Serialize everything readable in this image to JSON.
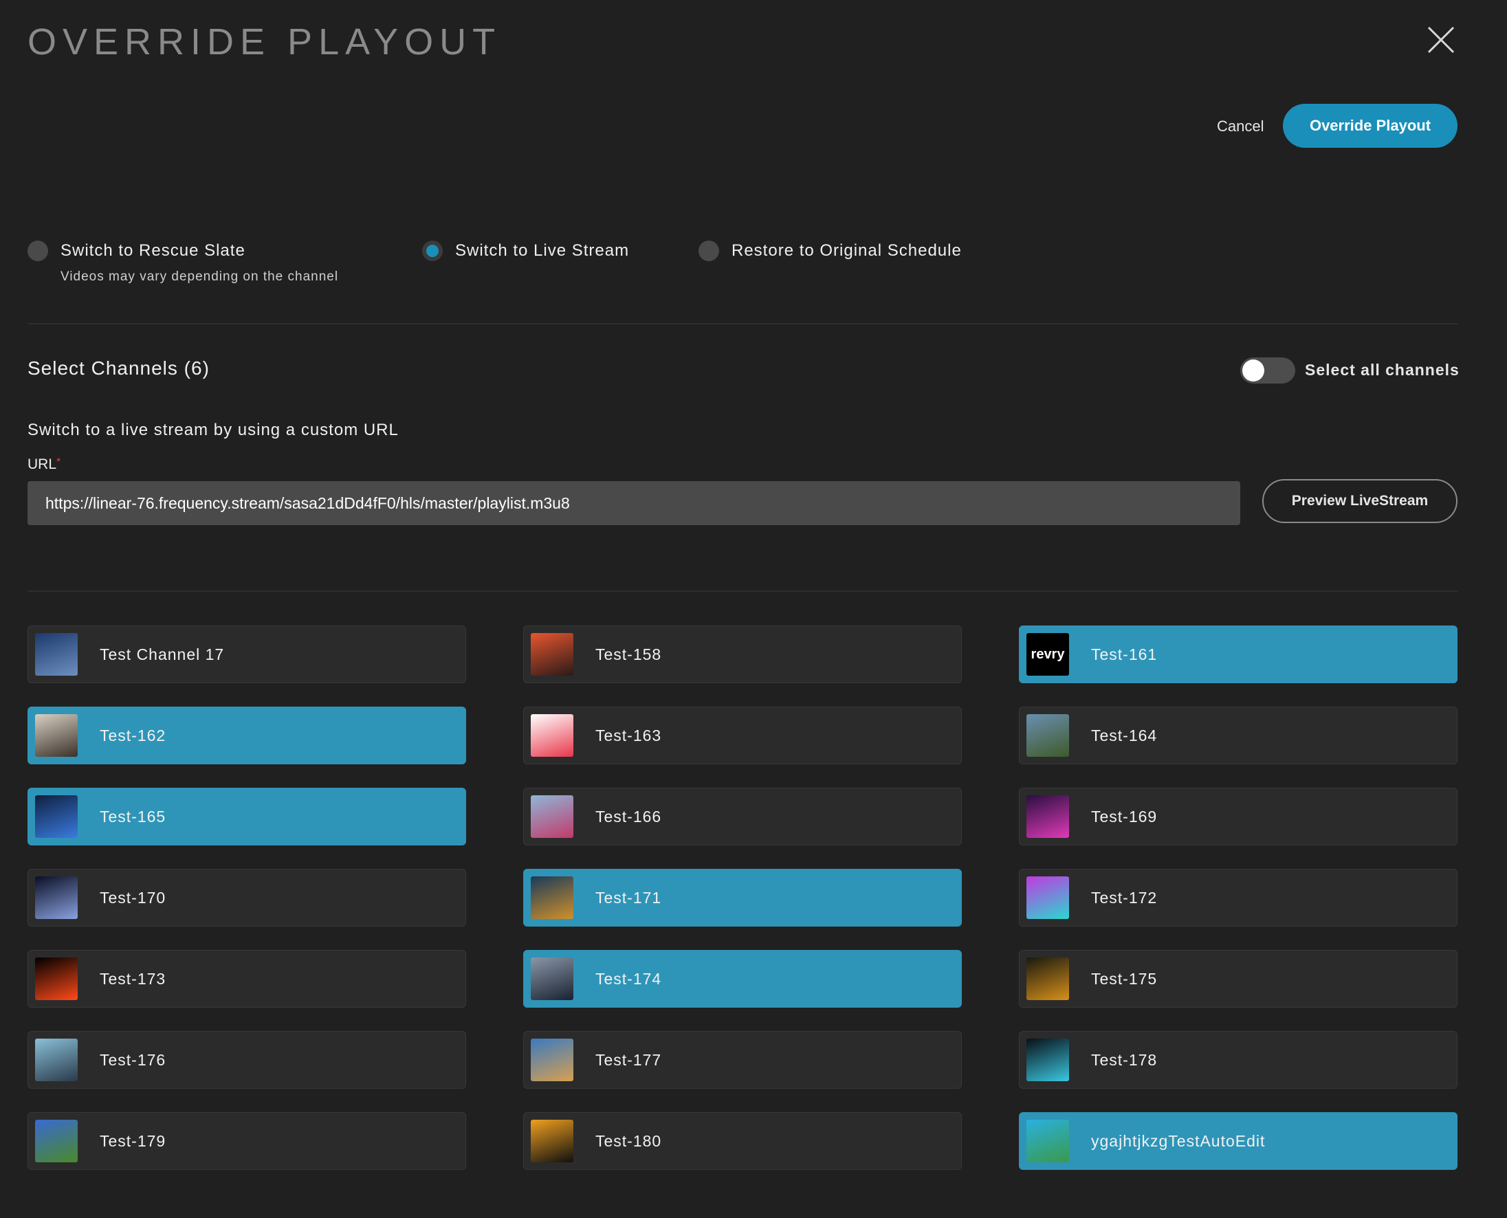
{
  "header": {
    "title": "OVERRIDE PLAYOUT",
    "close_icon": "close-icon"
  },
  "actions": {
    "cancel_label": "Cancel",
    "override_label": "Override Playout"
  },
  "options": [
    {
      "label": "Switch to Rescue Slate",
      "sub": "Videos may vary depending on the channel",
      "selected": false
    },
    {
      "label": "Switch to Live Stream",
      "selected": true
    },
    {
      "label": "Restore to Original Schedule",
      "selected": false
    }
  ],
  "channels_section": {
    "title": "Select Channels (6)",
    "select_all_label": "Select all channels",
    "select_all_on": false
  },
  "url_section": {
    "hint": "Switch to a live stream by using a custom URL",
    "label": "URL",
    "required_mark": "*",
    "value": "https://linear-76.frequency.stream/sasa21dDd4fF0/hls/master/playlist.m3u8",
    "preview_label": "Preview LiveStream"
  },
  "colors": {
    "accent": "#1a8fb9",
    "selected_card": "#2e95b8",
    "background": "#202020"
  },
  "channels": [
    {
      "name": "Test Channel 17",
      "selected": false,
      "thumb": [
        "#1b3a6b",
        "#6d8fc0"
      ]
    },
    {
      "name": "Test-158",
      "selected": false,
      "thumb": [
        "#e8562e",
        "#2a1a18"
      ]
    },
    {
      "name": "Test-161",
      "selected": true,
      "thumb": [
        "#000000",
        "#000000"
      ],
      "thumb_text": "revry"
    },
    {
      "name": "Test-162",
      "selected": true,
      "thumb": [
        "#d8d0c4",
        "#3a3028"
      ]
    },
    {
      "name": "Test-163",
      "selected": false,
      "thumb": [
        "#ffffff",
        "#e8364a"
      ]
    },
    {
      "name": "Test-164",
      "selected": false,
      "thumb": [
        "#6a8fb0",
        "#3f5a2a"
      ]
    },
    {
      "name": "Test-165",
      "selected": true,
      "thumb": [
        "#102040",
        "#3a7be0"
      ]
    },
    {
      "name": "Test-166",
      "selected": false,
      "thumb": [
        "#8fb6d8",
        "#c23a6a"
      ]
    },
    {
      "name": "Test-169",
      "selected": false,
      "thumb": [
        "#2a0f40",
        "#e03ab8"
      ]
    },
    {
      "name": "Test-170",
      "selected": false,
      "thumb": [
        "#0a0f25",
        "#8aa2e0"
      ]
    },
    {
      "name": "Test-171",
      "selected": true,
      "thumb": [
        "#1a3a5a",
        "#d0902a"
      ]
    },
    {
      "name": "Test-172",
      "selected": false,
      "thumb": [
        "#c03ae0",
        "#2ad8d0"
      ]
    },
    {
      "name": "Test-173",
      "selected": false,
      "thumb": [
        "#000000",
        "#ff4a1a"
      ]
    },
    {
      "name": "Test-174",
      "selected": true,
      "thumb": [
        "#8a96a8",
        "#1a2230"
      ]
    },
    {
      "name": "Test-175",
      "selected": false,
      "thumb": [
        "#1a1a10",
        "#d8901a"
      ]
    },
    {
      "name": "Test-176",
      "selected": false,
      "thumb": [
        "#8ac0d8",
        "#2a3a4a"
      ]
    },
    {
      "name": "Test-177",
      "selected": false,
      "thumb": [
        "#3a7ac0",
        "#d8a050"
      ]
    },
    {
      "name": "Test-178",
      "selected": false,
      "thumb": [
        "#0a1018",
        "#3ac8e0"
      ]
    },
    {
      "name": "Test-179",
      "selected": false,
      "thumb": [
        "#3a6ad0",
        "#4a8a2a"
      ]
    },
    {
      "name": "Test-180",
      "selected": false,
      "thumb": [
        "#f0a020",
        "#101010"
      ]
    },
    {
      "name": "ygajhtjkzgTestAutoEdit",
      "selected": true,
      "thumb": [
        "#2ab0e0",
        "#3a9a4a"
      ]
    }
  ]
}
